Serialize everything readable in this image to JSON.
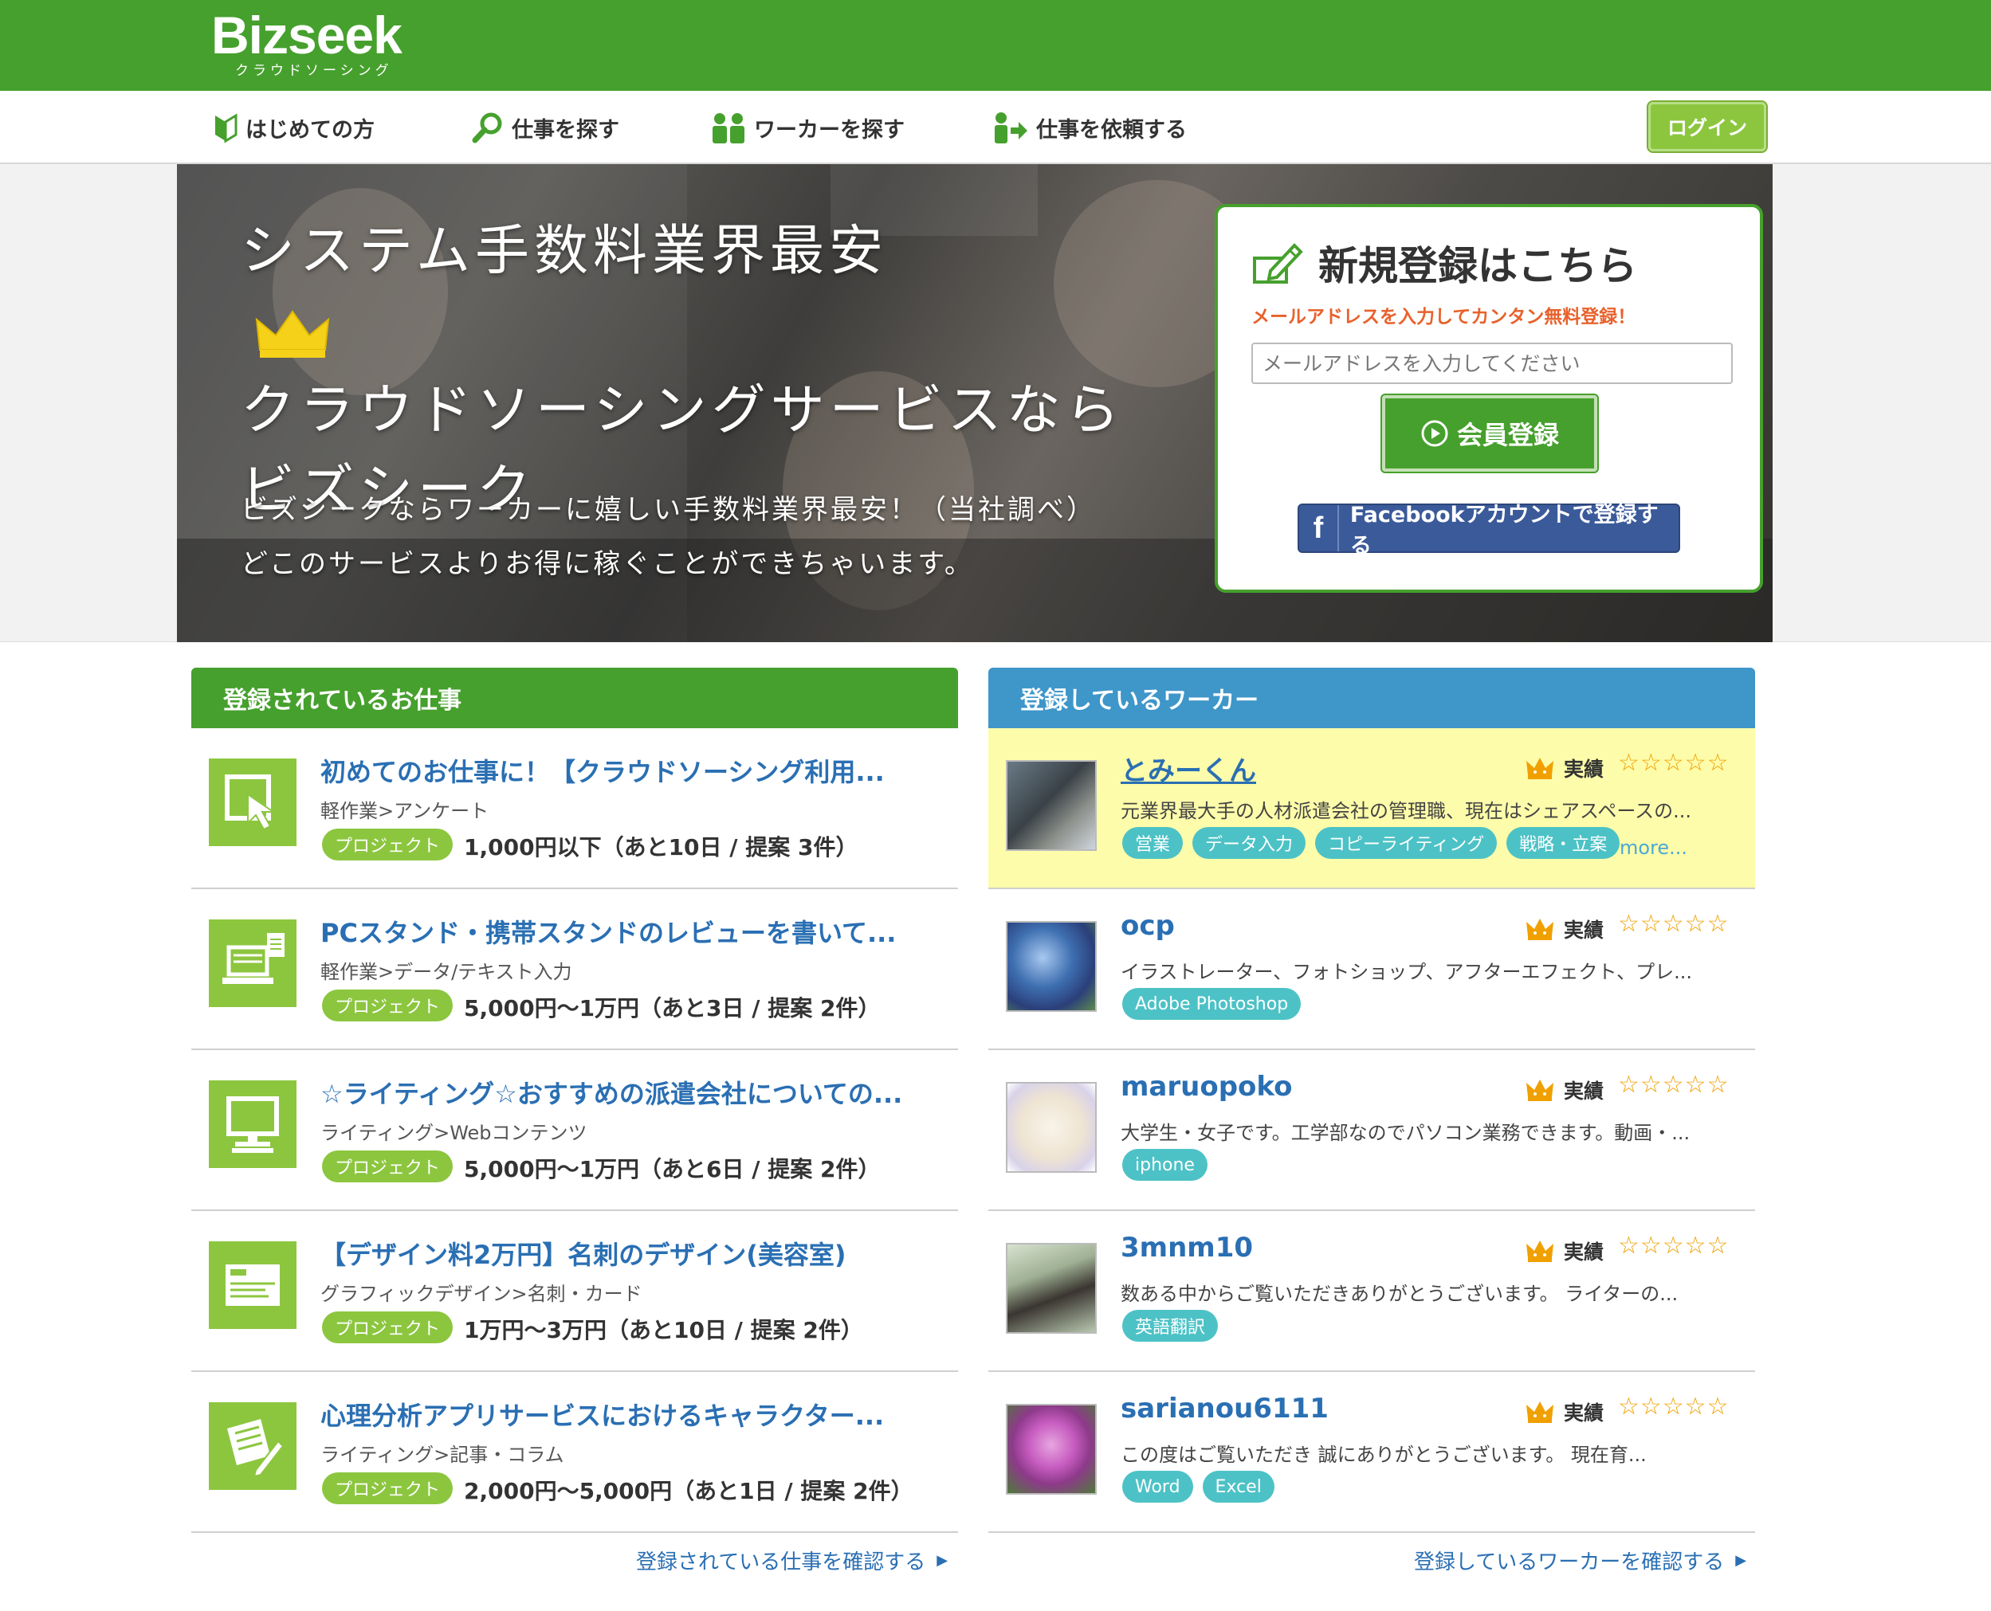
{
  "header": {
    "logo": "Bizseek",
    "logo_sub": "クラウドソーシング",
    "brand_color": "#46a02d"
  },
  "nav": {
    "items": [
      {
        "label": "はじめての方",
        "icon": "beginner-leaf-icon"
      },
      {
        "label": "仕事を探す",
        "icon": "search-icon"
      },
      {
        "label": "ワーカーを探す",
        "icon": "people-icon"
      },
      {
        "label": "仕事を依頼する",
        "icon": "request-icon"
      }
    ],
    "login": "ログイン"
  },
  "hero": {
    "line1": "システム手数料業界最安",
    "line2": "クラウドソーシングサービスなら",
    "line3": "ビズシーク",
    "sub1": "ビズシークならワーカーに嬉しい手数料業界最安！（当社調べ）",
    "sub2": "どこのサービスよりお得に稼ぐことができちゃいます。"
  },
  "register": {
    "title": "新規登録はこちら",
    "subtitle": "メールアドレスを入力してカンタン無料登録！",
    "email_placeholder": "メールアドレスを入力してください",
    "submit": "会員登録",
    "facebook_f": "f",
    "facebook": "Facebookアカウントで登録する"
  },
  "jobs": {
    "heading": "登録されているお仕事",
    "items": [
      {
        "title": "初めてのお仕事に！【クラウドソーシング利用...",
        "category": "軽作業>アンケート",
        "tag": "プロジェクト",
        "price": "1,000円以下（あと10日 / 提案 3件）",
        "icon": "cursor-icon"
      },
      {
        "title": "PCスタンド・携帯スタンドのレビューを書いて...",
        "category": "軽作業>データ/テキスト入力",
        "tag": "プロジェクト",
        "price": "5,000円〜1万円（あと3日 / 提案 2件）",
        "icon": "laptop-icon"
      },
      {
        "title": "☆ライティング☆おすすめの派遣会社についての...",
        "category": "ライティング>Webコンテンツ",
        "tag": "プロジェクト",
        "price": "5,000円〜1万円（あと6日 / 提案 2件）",
        "icon": "monitor-icon"
      },
      {
        "title": "【デザイン料2万円】名刺のデザイン(美容室)",
        "category": "グラフィックデザイン>名刺・カード",
        "tag": "プロジェクト",
        "price": "1万円〜3万円（あと10日 / 提案 2件）",
        "icon": "card-icon"
      },
      {
        "title": "心理分析アプリサービスにおけるキャラクター...",
        "category": "ライティング>記事・コラム",
        "tag": "プロジェクト",
        "price": "2,000円〜5,000円（あと1日 / 提案 2件）",
        "icon": "writing-icon"
      }
    ],
    "more": "登録されている仕事を確認する"
  },
  "workers": {
    "heading": "登録しているワーカー",
    "achievement_label": "実績",
    "stars": "☆☆☆☆☆",
    "more_tags": "more...",
    "items": [
      {
        "name": "とみーくん",
        "desc": "元業界最大手の人材派遣会社の管理職、現在はシェアスペースの...",
        "tags": [
          "営業",
          "データ入力",
          "コピーライティング",
          "戦略・立案"
        ]
      },
      {
        "name": "ocp",
        "desc": "イラストレーター、フォトショップ、アフターエフェクト、プレ...",
        "tags": [
          "Adobe Photoshop"
        ]
      },
      {
        "name": "maruopoko",
        "desc": "大学生・女子です。工学部なのでパソコン業務できます。動画・...",
        "tags": [
          "iphone"
        ]
      },
      {
        "name": "3mnm10",
        "desc": "数ある中からご覧いただきありがとうございます。 ライターの...",
        "tags": [
          "英語翻訳"
        ]
      },
      {
        "name": "sarianou6111",
        "desc": "この度はご覧いただき 誠にありがとうございます。 現在育...",
        "tags": [
          "Word",
          "Excel"
        ]
      }
    ],
    "more": "登録しているワーカーを確認する"
  }
}
